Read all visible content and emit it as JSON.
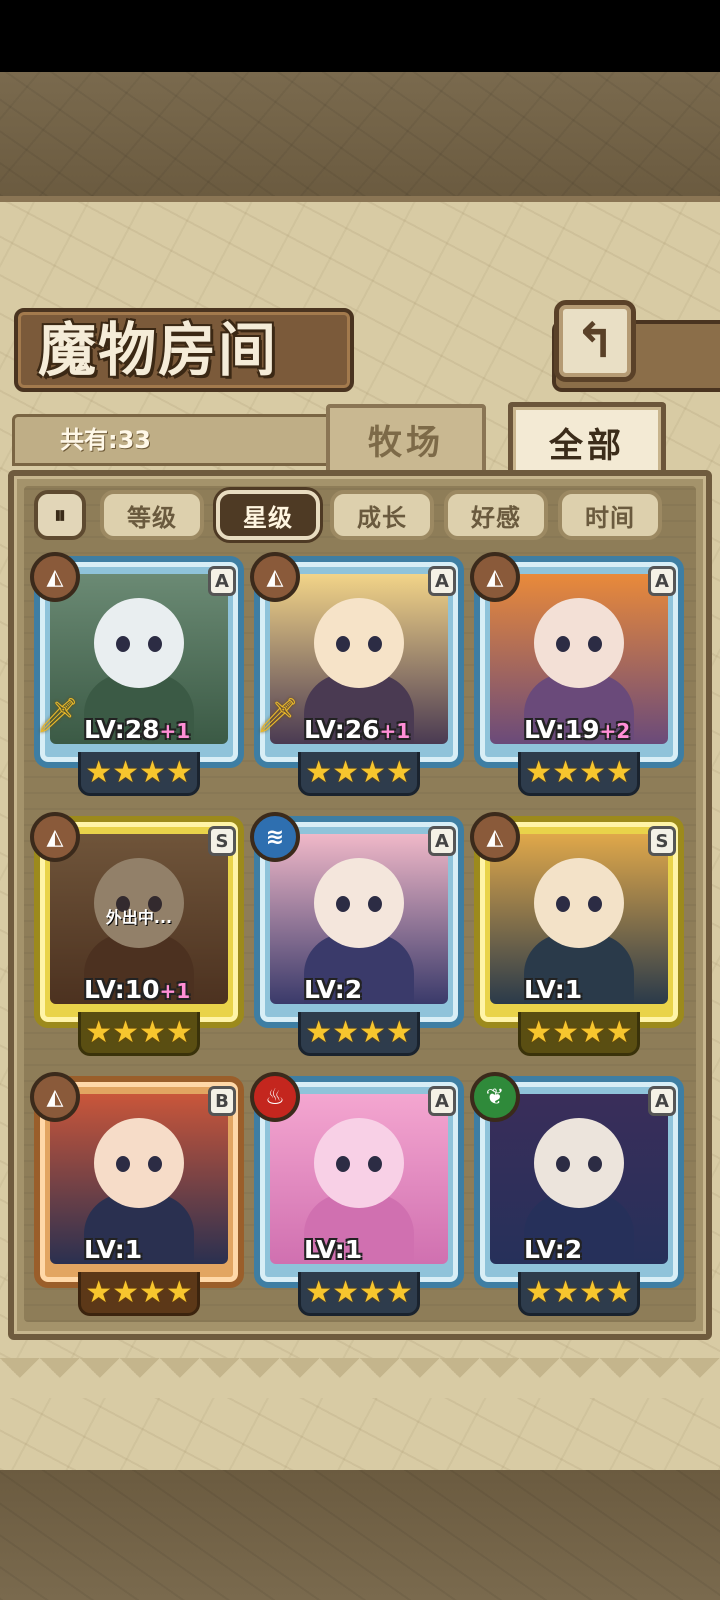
{
  "screen": {
    "title": "魔物房间",
    "back_icon": "return-arrow-icon",
    "count_label": "共有:33",
    "tabs": [
      {
        "label": "牧场",
        "active": false
      },
      {
        "label": "全部",
        "active": true
      }
    ],
    "sort_toggle_icon": "pause-sort-icon",
    "filters": [
      {
        "label": "等级",
        "active": false
      },
      {
        "label": "星级",
        "active": true
      },
      {
        "label": "成长",
        "active": false
      },
      {
        "label": "好感",
        "active": false
      },
      {
        "label": "时间",
        "active": false
      }
    ]
  },
  "monsters": [
    {
      "element": "earth",
      "rank": "A",
      "level": "LV:28",
      "bonus": "+1",
      "weapon": true,
      "stars": 4,
      "status": ""
    },
    {
      "element": "earth",
      "rank": "A",
      "level": "LV:26",
      "bonus": "+1",
      "weapon": true,
      "stars": 4,
      "status": ""
    },
    {
      "element": "earth",
      "rank": "A",
      "level": "LV:19",
      "bonus": "+2",
      "weapon": false,
      "stars": 4,
      "status": ""
    },
    {
      "element": "earth",
      "rank": "S",
      "level": "LV:10",
      "bonus": "+1",
      "weapon": false,
      "stars": 4,
      "status": "外出中..."
    },
    {
      "element": "water",
      "rank": "A",
      "level": "LV:2",
      "bonus": "",
      "weapon": false,
      "stars": 4,
      "status": ""
    },
    {
      "element": "earth",
      "rank": "S",
      "level": "LV:1",
      "bonus": "",
      "weapon": false,
      "stars": 4,
      "status": ""
    },
    {
      "element": "earth",
      "rank": "B",
      "level": "LV:1",
      "bonus": "",
      "weapon": false,
      "stars": 4,
      "status": ""
    },
    {
      "element": "fire",
      "rank": "A",
      "level": "LV:1",
      "bonus": "",
      "weapon": false,
      "stars": 4,
      "status": ""
    },
    {
      "element": "wood",
      "rank": "A",
      "level": "LV:2",
      "bonus": "",
      "weapon": false,
      "stars": 4,
      "status": ""
    }
  ]
}
